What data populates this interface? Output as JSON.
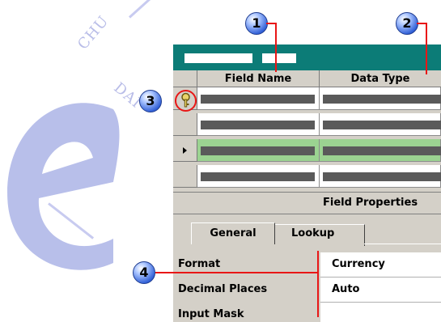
{
  "watermark": {
    "lines": [
      "CHU",
      "DAI"
    ]
  },
  "callouts": [
    "1",
    "2",
    "3",
    "4"
  ],
  "table": {
    "headers": [
      "Field Name",
      "Data Type"
    ],
    "rows": [
      {
        "primary_key": true,
        "current": false
      },
      {
        "primary_key": false,
        "current": false
      },
      {
        "primary_key": false,
        "current": true
      },
      {
        "primary_key": false,
        "current": false
      }
    ]
  },
  "field_properties": {
    "title": "Field Properties",
    "tabs": [
      "General",
      "Lookup"
    ],
    "active_tab": "General",
    "properties": [
      {
        "label": "Format",
        "value": "Currency"
      },
      {
        "label": "Decimal Places",
        "value": "Auto"
      },
      {
        "label": "Input Mask",
        "value": ""
      }
    ]
  },
  "colors": {
    "titlebar": "#0c7c77",
    "current_row": "#9bd391",
    "callout_line": "#e81616"
  }
}
